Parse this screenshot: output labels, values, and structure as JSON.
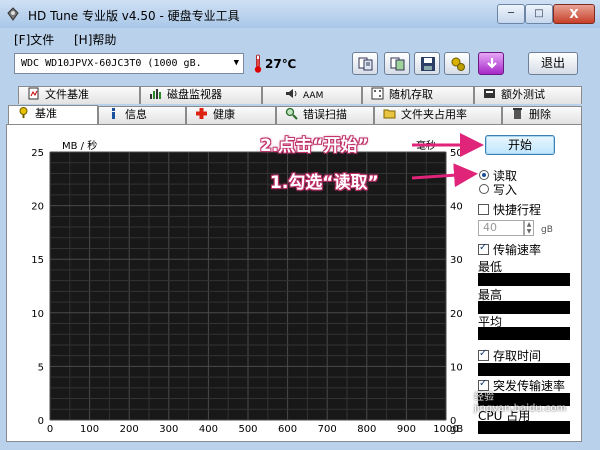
{
  "window": {
    "title": "HD Tune 专业版 v4.50 - 硬盘专业工具",
    "min_label": "─",
    "max_label": "□",
    "close_label": "X"
  },
  "menu": [
    {
      "label": "[F]文件"
    },
    {
      "label": "[H]帮助"
    }
  ],
  "toolbar": {
    "drive": "WDC WD10JPVX-60JC3T0    (1000 gB.",
    "drive_arrow": "▼",
    "temperature": "27℃",
    "exit_label": "退出",
    "buttons": [
      {
        "icon": "copy-text-icon"
      },
      {
        "icon": "copy-screen-icon"
      },
      {
        "icon": "save-icon"
      },
      {
        "icon": "options-icon"
      },
      {
        "icon": "download-icon"
      }
    ]
  },
  "tabs_row1": [
    {
      "label": "文件基准",
      "icon": "file-benchmark-icon"
    },
    {
      "label": "磁盘监视器",
      "icon": "disk-monitor-icon"
    },
    {
      "label": "AAM",
      "icon": "speaker-icon"
    },
    {
      "label": "随机存取",
      "icon": "random-access-icon"
    },
    {
      "label": "额外测试",
      "icon": "extra-tests-icon"
    }
  ],
  "tabs_row2": [
    {
      "label": "基准",
      "icon": "benchmark-icon",
      "active": true
    },
    {
      "label": "信息",
      "icon": "info-icon"
    },
    {
      "label": "健康",
      "icon": "health-icon"
    },
    {
      "label": "错误扫描",
      "icon": "error-scan-icon"
    },
    {
      "label": "文件夹占用率",
      "icon": "folder-usage-icon"
    },
    {
      "label": "删除",
      "icon": "erase-icon"
    }
  ],
  "controls": {
    "start_label": "开始",
    "read_label": "读取",
    "write_label": "写入",
    "read_selected": true,
    "short_stroke_label": "快捷行程",
    "short_stroke_value": "40",
    "short_stroke_unit": "gB",
    "transfer_rate_label": "传输速率",
    "min_label": "最低",
    "max_label": "最高",
    "avg_label": "平均",
    "access_time_label": "存取时间",
    "burst_rate_label": "突发传输速率",
    "cpu_label": "CPU 占用"
  },
  "chart_data": {
    "type": "line",
    "ylabel": "MB / 秒",
    "ylabel_right": "毫秒",
    "xlabel": "",
    "x_unit": "gB",
    "xlim": [
      0,
      1000
    ],
    "ylim": [
      0,
      25
    ],
    "ylim_right": [
      0,
      50
    ],
    "x_ticks": [
      0,
      100,
      200,
      300,
      400,
      500,
      600,
      700,
      800,
      900,
      1000
    ],
    "y_ticks": [
      0,
      5,
      10,
      15,
      20,
      25
    ],
    "y_ticks_right": [
      0,
      10,
      20,
      30,
      40,
      50
    ],
    "grid": true,
    "series": []
  },
  "annotations": {
    "step2": "2.点击“开始”",
    "step1": "1.勾选“读取”"
  },
  "watermark": "经验 jingyan.baidu.com"
}
